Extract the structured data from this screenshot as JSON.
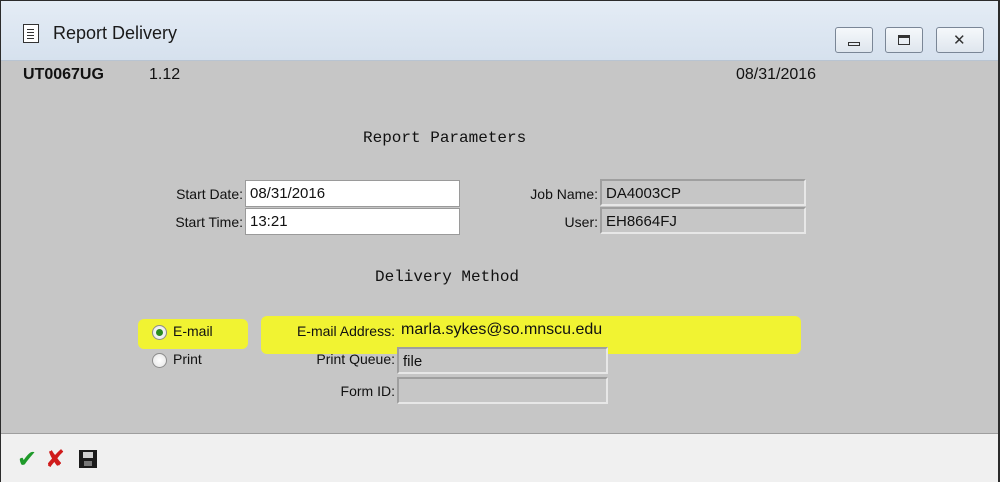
{
  "window": {
    "title": "Report Delivery",
    "program_id": "UT0067UG",
    "version": "1.12",
    "date": "08/31/2016"
  },
  "report_parameters": {
    "heading": "Report Parameters",
    "start_date_label": "Start Date:",
    "start_date": "08/31/2016",
    "start_time_label": "Start Time:",
    "start_time": "13:21",
    "job_name_label": "Job Name:",
    "job_name": "DA4003CP",
    "user_label": "User:",
    "user": "EH8664FJ"
  },
  "delivery_method": {
    "heading": "Delivery Method",
    "email_option": "E-mail",
    "print_option": "Print",
    "selected": "E-mail",
    "email_address_label": "E-mail Address:",
    "email_address": "marla.sykes@so.mnscu.edu",
    "print_queue_label": "Print Queue:",
    "print_queue": "file",
    "form_id_label": "Form ID:",
    "form_id": ""
  },
  "highlight_color": "#f3f52a",
  "toolbar": {
    "icons": [
      "checkmark-icon",
      "x-icon",
      "save-disk-icon"
    ]
  }
}
